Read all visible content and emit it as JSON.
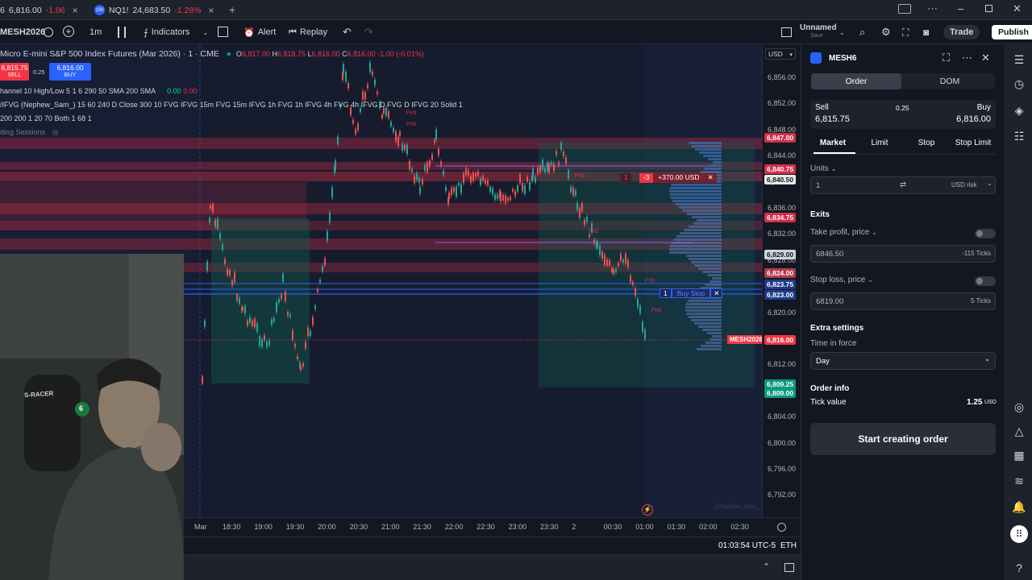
{
  "tabs": [
    {
      "icon": "S",
      "symbol": "6",
      "price": "6,816.00",
      "change": "-1.06",
      "close": "×"
    },
    {
      "icon": "100",
      "symbol": "NQ1!",
      "price": "24,683.50",
      "change": "-1.28%",
      "close": "×"
    }
  ],
  "toolbar": {
    "symbol": "MESH2026",
    "interval": "1m",
    "indicators": "Indicators",
    "alert": "Alert",
    "replay": "Replay",
    "layout_name": "Unnamed",
    "layout_sub": "Save",
    "trade": "Trade",
    "publish": "Publish"
  },
  "legend": {
    "title": "Micro E-mini S&P 500 Index Futures (Mar 2026) · 1 · CME",
    "o_label": "O",
    "o": "6,817.00",
    "h_label": "H",
    "h": "6,818.75",
    "l_label": "L",
    "l": "6,816.00",
    "c_label": "C",
    "c": "6,816.00",
    "change": "-1.00 (-0.01%)",
    "sell_price": "6,815.75",
    "sell_label": "SELL",
    "spread": "0.25",
    "buy_price": "6,816.00",
    "buy_label": "BUY",
    "ind1_label": "hannel 10 High/Low 5 1 6 290 50 SMA 200 SMA",
    "ind1_v1": "0.00",
    "ind1_v2": "0.00",
    "ind2_label": "/IFVG (Nephew_Sam_) 15 60 240 D Close 300 10 FVG IFVG 15m FVG 15m IFVG 1h FVG 1h IFVG 4h FVG 4h IFVG D FVG D IFVG 20 Solid 1",
    "ind3_label": "200 200 1 20 70 Both 1 68 1",
    "ind4_label": "ding Sessions"
  },
  "price_scale": {
    "currency": "USD",
    "labels": [
      "6,856.00",
      "6,852.00",
      "6,848.00",
      "6,844.00",
      "6,840.00",
      "6,836.00",
      "6,832.00",
      "6,828.00",
      "6,824.00",
      "6,820.00",
      "6,816.00",
      "6,812.00",
      "6,808.00",
      "6,804.00",
      "6,800.00",
      "6,796.00",
      "6,792.00"
    ],
    "tags": [
      {
        "text": "6,847.00",
        "color": "#d32f4a"
      },
      {
        "text": "6,840.75",
        "color": "#d32f4a"
      },
      {
        "text": "6,840.50",
        "color": "#e8e8e8"
      },
      {
        "text": "6,834.75",
        "color": "#d32f4a"
      },
      {
        "text": "6,829.00",
        "color": "#cfd3dc"
      },
      {
        "text": "6,824.00",
        "color": "#b23a48"
      },
      {
        "text": "6,823.75",
        "color": "#1e3a8a"
      },
      {
        "text": "6,823.00",
        "color": "#1e3a8a"
      },
      {
        "text": "6,816.00",
        "color": "#f23645"
      },
      {
        "text": "6,809.25",
        "color": "#089981"
      },
      {
        "text": "6,809.00",
        "color": "#089981"
      }
    ]
  },
  "time_axis": [
    "Mar",
    "18:30",
    "19:00",
    "19:30",
    "20:00",
    "20:30",
    "21:00",
    "21:30",
    "22:00",
    "22:30",
    "23:00",
    "23:30",
    "2",
    "00:30",
    "01:00",
    "01:30",
    "02:00",
    "02:30"
  ],
  "chart": {
    "position_qty": "1",
    "position_close": "-3",
    "position_pnl": "+370.00 USD",
    "order_label": "Buy Stop",
    "order_qty": "1",
    "price_tag": "MESH2026",
    "price_tag_value": "6,816.00",
    "fvg": "FVG",
    "watermark": "@Nephew_Sam_"
  },
  "status": {
    "time": "01:03:54 UTC-5",
    "session": "ETH"
  },
  "panel": {
    "symbol": "MESH6",
    "tab_order": "Order",
    "tab_dom": "DOM",
    "sell_label": "Sell",
    "sell_price": "6,815.75",
    "spread": "0.25",
    "buy_label": "Buy",
    "buy_price": "6,816.00",
    "order_types": [
      "Market",
      "Limit",
      "Stop",
      "Stop Limit"
    ],
    "units_label": "Units",
    "units_value": "1",
    "risk_label": "USD risk",
    "exits_label": "Exits",
    "tp_label": "Take profit, price",
    "tp_value": "6846.50",
    "tp_ticks": "-115 Ticks",
    "sl_label": "Stop loss, price",
    "sl_value": "6819.00",
    "sl_ticks": "5 Ticks",
    "extra_label": "Extra settings",
    "tif_label": "Time in force",
    "tif_value": "Day",
    "info_label": "Order info",
    "tick_label": "Tick value",
    "tick_value": "1.25",
    "tick_unit": "USD",
    "cta": "Start creating order"
  },
  "webcam": {
    "overlay": "S-RACER",
    "badge": "6"
  },
  "colors": {
    "bg": "#131722",
    "red": "#f23645",
    "green": "#089981",
    "blue": "#2962ff"
  }
}
